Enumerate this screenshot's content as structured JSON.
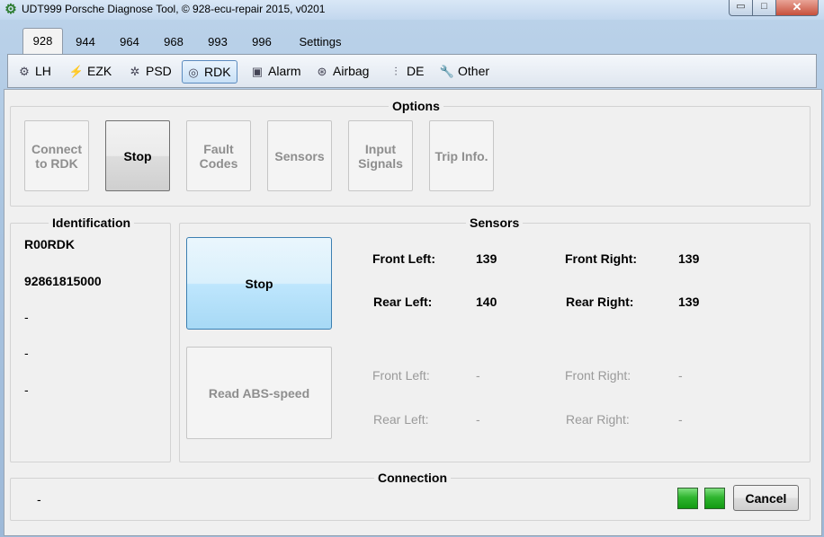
{
  "window": {
    "title": "UDT999 Porsche Diagnose Tool, © 928-ecu-repair 2015, v0201",
    "minimize_icon": "▭",
    "maximize_icon": "□",
    "close_icon": "✕"
  },
  "top_tabs": [
    {
      "label": "928",
      "active": true
    },
    {
      "label": "944"
    },
    {
      "label": "964"
    },
    {
      "label": "968"
    },
    {
      "label": "993"
    },
    {
      "label": "996"
    },
    {
      "label": "Settings"
    }
  ],
  "sub_tabs": [
    {
      "label": "LH",
      "icon": "engine-icon"
    },
    {
      "label": "EZK",
      "icon": "spark-icon"
    },
    {
      "label": "PSD",
      "icon": "gears-icon"
    },
    {
      "label": "RDK",
      "icon": "tire-icon",
      "active": true
    },
    {
      "label": "Alarm",
      "icon": "lock-icon"
    },
    {
      "label": "Airbag",
      "icon": "steering-wheel-icon"
    },
    {
      "label": "DE",
      "icon": "injector-icon"
    },
    {
      "label": "Other",
      "icon": "wrench-icon"
    }
  ],
  "options": {
    "title": "Options",
    "buttons": [
      {
        "label": "Connect to RDK",
        "enabled": false
      },
      {
        "label": "Stop",
        "enabled": true
      },
      {
        "label": "Fault Codes",
        "enabled": false
      },
      {
        "label": "Sensors",
        "enabled": false
      },
      {
        "label": "Input Signals",
        "enabled": false
      },
      {
        "label": "Trip Info.",
        "enabled": false
      }
    ]
  },
  "identification": {
    "title": "Identification",
    "values": [
      "R00RDK",
      "92861815000",
      "-",
      "-",
      "-"
    ]
  },
  "sensors": {
    "title": "Sensors",
    "stop_label": "Stop",
    "read_abs_label": "Read ABS-speed",
    "pressure": {
      "front_left_label": "Front Left:",
      "front_left_value": "139",
      "front_right_label": "Front Right:",
      "front_right_value": "139",
      "rear_left_label": "Rear Left:",
      "rear_left_value": "140",
      "rear_right_label": "Rear Right:",
      "rear_right_value": "139"
    },
    "abs": {
      "front_left_label": "Front Left:",
      "front_left_value": "-",
      "front_right_label": "Front Right:",
      "front_right_value": "-",
      "rear_left_label": "Rear Left:",
      "rear_left_value": "-",
      "rear_right_label": "Rear Right:",
      "rear_right_value": "-"
    }
  },
  "connection": {
    "title": "Connection",
    "status": "-",
    "cancel_label": "Cancel",
    "led_color": "#22aa22"
  }
}
